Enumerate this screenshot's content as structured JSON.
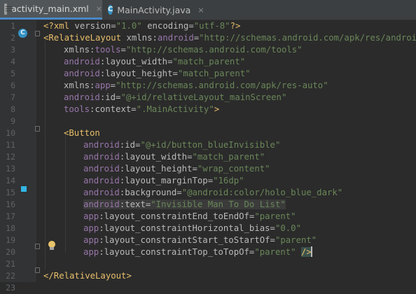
{
  "tabs": [
    {
      "label": "activity_main.xml",
      "icon": "xml-file-icon",
      "active": true
    },
    {
      "label": "MainActivity.java",
      "icon": "java-class-icon",
      "active": false
    }
  ],
  "close_glyph": "×",
  "gutter": {
    "class_marker_letter": "C",
    "color_swatch": "#33b5e5"
  },
  "lines": [
    {
      "n": "1"
    },
    {
      "n": "2"
    },
    {
      "n": "3"
    },
    {
      "n": "4"
    },
    {
      "n": "5"
    },
    {
      "n": "6"
    },
    {
      "n": "7"
    },
    {
      "n": "8"
    },
    {
      "n": "9"
    },
    {
      "n": "10"
    },
    {
      "n": "11"
    },
    {
      "n": "12"
    },
    {
      "n": "13"
    },
    {
      "n": "14"
    },
    {
      "n": "15"
    },
    {
      "n": "16"
    },
    {
      "n": "17"
    },
    {
      "n": "18"
    },
    {
      "n": "19"
    },
    {
      "n": "20"
    },
    {
      "n": "21"
    },
    {
      "n": "22"
    },
    {
      "n": "23"
    }
  ],
  "code": {
    "l1": {
      "open": "<?",
      "name": "xml",
      "a1": " version=",
      "v1": "\"1.0\"",
      "a2": " encoding=",
      "v2": "\"utf-8\"",
      "close": "?>"
    },
    "l2": {
      "tag": "<RelativeLayout",
      "sp": " ",
      "ns": "xmlns",
      "colon": ":",
      "attr": "android",
      "eq": "=",
      "val": "\"http://schemas.android.com/apk/res/android\""
    },
    "l3": {
      "ns": "xmlns",
      "colon": ":",
      "attr": "tools",
      "eq": "=",
      "val": "\"http://schemas.android.com/tools\""
    },
    "l4": {
      "ns": "android",
      "colon": ":",
      "attr": "layout_width",
      "eq": "=",
      "val": "\"match_parent\""
    },
    "l5": {
      "ns": "android",
      "colon": ":",
      "attr": "layout_height",
      "eq": "=",
      "val": "\"match_parent\""
    },
    "l6": {
      "ns": "xmlns",
      "colon": ":",
      "attr": "app",
      "eq": "=",
      "val": "\"http://schemas.android.com/apk/res-auto\""
    },
    "l7": {
      "ns": "android",
      "colon": ":",
      "attr": "id",
      "eq": "=",
      "val": "\"@+id/relativeLayout_mainScreen\""
    },
    "l8": {
      "ns": "tools",
      "colon": ":",
      "attr": "context",
      "eq": "=",
      "val": "\".MainActivity\"",
      "close": ">"
    },
    "l10": {
      "tag": "<Button"
    },
    "l11": {
      "ns": "android",
      "colon": ":",
      "attr": "id",
      "eq": "=",
      "val": "\"@+id/button_blueInvisible\""
    },
    "l12": {
      "ns": "android",
      "colon": ":",
      "attr": "layout_width",
      "eq": "=",
      "val": "\"match_parent\""
    },
    "l13": {
      "ns": "android",
      "colon": ":",
      "attr": "layout_height",
      "eq": "=",
      "val": "\"wrap_content\""
    },
    "l14": {
      "ns": "android",
      "colon": ":",
      "attr": "layout_marginTop",
      "eq": "=",
      "val": "\"16dp\""
    },
    "l15": {
      "ns": "android",
      "colon": ":",
      "attr": "background",
      "eq": "=",
      "val": "\"@android:color/holo_blue_dark\""
    },
    "l16": {
      "ns": "android",
      "colon": ":",
      "attr": "text",
      "eq": "=",
      "val": "\"Invisible Man To Do List\""
    },
    "l17": {
      "ns": "app",
      "colon": ":",
      "attr": "layout_constraintEnd_toEndOf",
      "eq": "=",
      "val": "\"parent\""
    },
    "l18": {
      "ns": "app",
      "colon": ":",
      "attr": "layout_constraintHorizontal_bias",
      "eq": "=",
      "val": "\"0.0\""
    },
    "l19": {
      "ns": "app",
      "colon": ":",
      "attr": "layout_constraintStart_toStartOf",
      "eq": "=",
      "val": "\"parent\""
    },
    "l20": {
      "ns": "app",
      "colon": ":",
      "attr": "layout_constraintTop_toTopOf",
      "eq": "=",
      "val": "\"parent\"",
      "sp": " ",
      "close": "/>"
    },
    "l22": {
      "tag": "</RelativeLayout",
      "close": ">"
    }
  }
}
